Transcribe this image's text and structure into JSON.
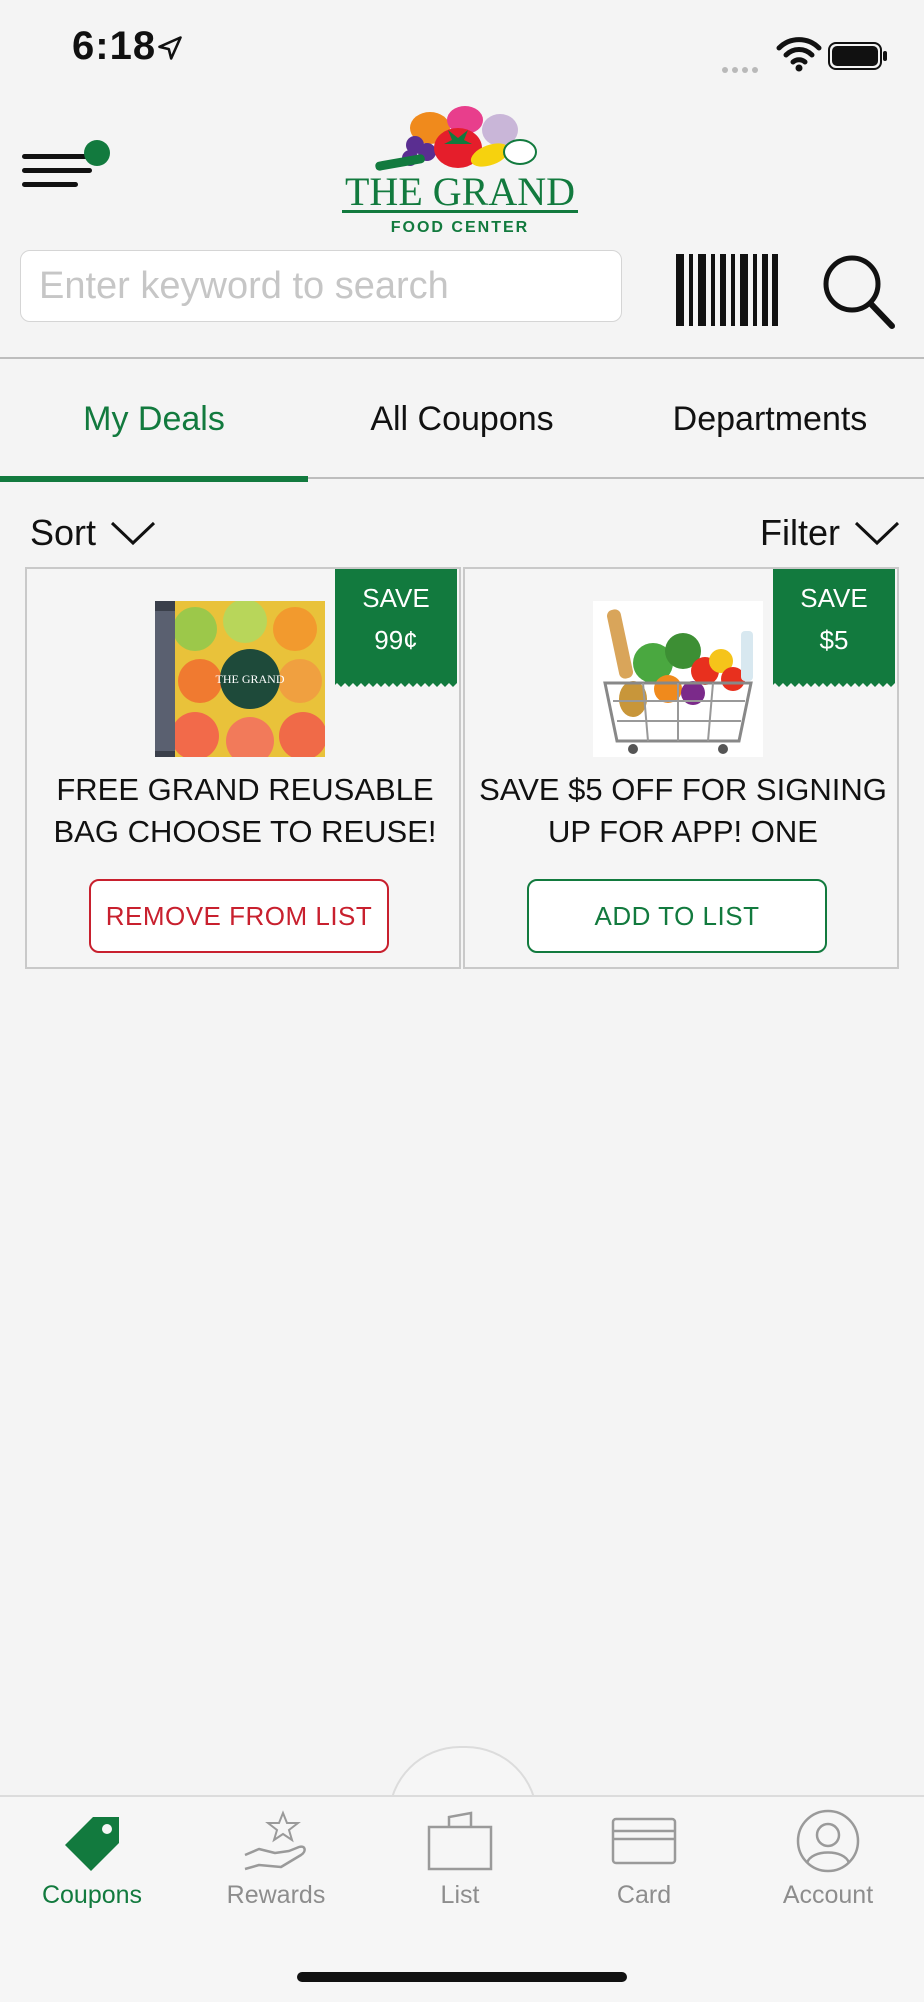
{
  "status_bar": {
    "time": "6:18"
  },
  "search": {
    "placeholder": "Enter keyword to search"
  },
  "tabs": [
    {
      "label": "My Deals",
      "active": true
    },
    {
      "label": "All Coupons",
      "active": false
    },
    {
      "label": "Departments",
      "active": false
    }
  ],
  "controls": {
    "sort_label": "Sort",
    "filter_label": "Filter"
  },
  "coupons": [
    {
      "badge_line1": "SAVE",
      "badge_line2": "99¢",
      "description": "FREE GRAND REUSABLE BAG CHOOSE TO REUSE!",
      "button_label": "REMOVE FROM LIST",
      "image_icon": "reusable-bag-image"
    },
    {
      "badge_line1": "SAVE",
      "badge_line2": "$5",
      "description": "SAVE $5  OFF FOR SIGNING UP FOR APP! ONE",
      "button_label": "ADD TO LIST",
      "image_icon": "grocery-basket-image"
    }
  ],
  "bottom_nav": [
    {
      "label": "Coupons",
      "icon": "tag-icon",
      "active": true
    },
    {
      "label": "Rewards",
      "icon": "rewards-hand-star-icon",
      "active": false
    },
    {
      "label": "List",
      "icon": "bag-icon",
      "active": false
    },
    {
      "label": "Card",
      "icon": "card-icon",
      "active": false
    },
    {
      "label": "Account",
      "icon": "account-icon",
      "active": false
    }
  ],
  "brand": {
    "name_line1": "THE GRAND",
    "name_line2": "FOOD CENTER",
    "accent_color": "#127a3e",
    "remove_color": "#c8202e"
  }
}
